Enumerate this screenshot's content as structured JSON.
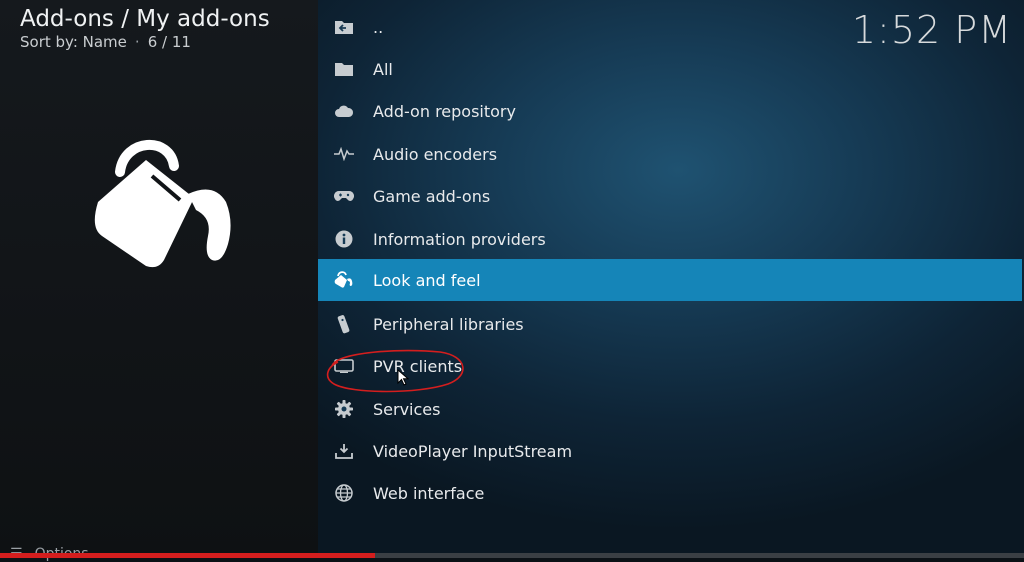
{
  "header": {
    "title": "Add-ons / My add-ons",
    "sort_label": "Sort by: Name",
    "separator": "·",
    "position": "6 / 11"
  },
  "clock": "1:52 PM",
  "preview": {
    "icon": "paint-bucket-icon"
  },
  "menu": {
    "items": [
      {
        "label": "..",
        "icon": "back-folder-icon"
      },
      {
        "label": "All",
        "icon": "folder-icon"
      },
      {
        "label": "Add-on repository",
        "icon": "cloud-icon"
      },
      {
        "label": "Audio encoders",
        "icon": "waveform-icon"
      },
      {
        "label": "Game add-ons",
        "icon": "gamepad-icon"
      },
      {
        "label": "Information providers",
        "icon": "info-icon"
      },
      {
        "label": "Look and feel",
        "icon": "paint-bucket-icon",
        "selected": true
      },
      {
        "label": "Peripheral libraries",
        "icon": "remote-icon"
      },
      {
        "label": "PVR clients",
        "icon": "tv-icon"
      },
      {
        "label": "Services",
        "icon": "gear-icon"
      },
      {
        "label": "VideoPlayer InputStream",
        "icon": "download-tray-icon"
      },
      {
        "label": "Web interface",
        "icon": "globe-icon"
      }
    ]
  },
  "footer": {
    "options_label": "Options"
  },
  "video_progress": 0.366,
  "colors": {
    "selection": "#1585b8",
    "annotation": "#d41e1e",
    "progress": "#d41e1e"
  }
}
